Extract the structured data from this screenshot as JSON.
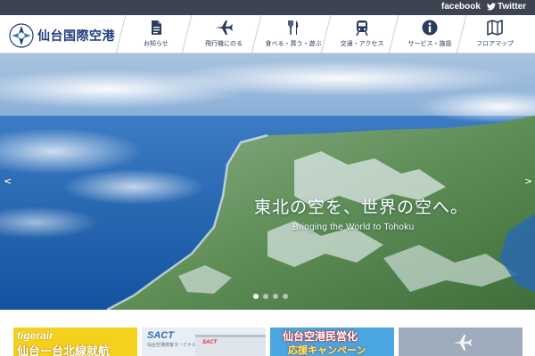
{
  "social": {
    "facebook": "facebook",
    "twitter": "Twitter"
  },
  "logo": {
    "text": "仙台国際空港"
  },
  "nav": [
    {
      "label": "お知らせ",
      "icon": "document-icon"
    },
    {
      "label": "飛行機にのる",
      "icon": "airplane-icon"
    },
    {
      "label": "食べる・買う・遊ぶ",
      "icon": "fork-knife-icon"
    },
    {
      "label": "交通・アクセス",
      "icon": "train-icon"
    },
    {
      "label": "サービス・施設",
      "icon": "info-icon"
    },
    {
      "label": "フロアマップ",
      "icon": "map-icon"
    }
  ],
  "hero": {
    "title": "東北の空を、世界の空へ。",
    "subtitle": "Bringing the World to Tohoku",
    "prev": "<",
    "next": ">",
    "slide_count": 4,
    "active_slide": 1
  },
  "banners": {
    "tigerair": {
      "brand": "tigerair",
      "headline": "仙台ー台北線就航"
    },
    "sact": {
      "brand": "SACT",
      "sub": "仙台空港旅客ターミナル",
      "building_sign": "SACT"
    },
    "campaign": {
      "line1": "仙台空港民営化",
      "line2": "応援キャンペーン"
    }
  },
  "colors": {
    "topbar": "#3d4350",
    "brand_navy": "#1f3b7a",
    "nav_text": "#2a3b5c",
    "tigerair_yellow": "#f4d11f",
    "campaign_blue": "#4aa6e0"
  }
}
